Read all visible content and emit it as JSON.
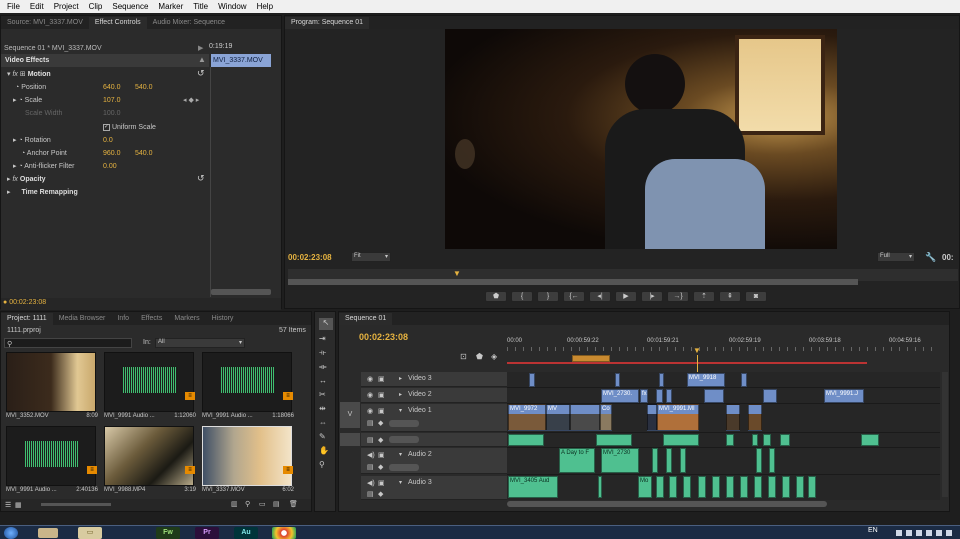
{
  "menu": [
    "File",
    "Edit",
    "Project",
    "Clip",
    "Sequence",
    "Marker",
    "Title",
    "Window",
    "Help"
  ],
  "source_tabs": [
    "Source: MVI_3337.MOV",
    "Effect Controls",
    "Audio Mixer: Sequence"
  ],
  "effect_controls": {
    "clip_path": "Sequence 01 * MVI_3337.MOV",
    "ruler_time": "0:19:19",
    "clip_name": "MVI_3337.MOV",
    "heading": "Video Effects",
    "motion": "Motion",
    "position_label": "Position",
    "position_x": "640.0",
    "position_y": "540.0",
    "scale_label": "Scale",
    "scale_value": "107.0",
    "scale_width_label": "Scale Width",
    "scale_width_value": "100.0",
    "uniform_scale": "Uniform Scale",
    "rotation_label": "Rotation",
    "rotation_value": "0.0",
    "anchor_label": "Anchor Point",
    "anchor_x": "960.0",
    "anchor_y": "540.0",
    "antiflicker_label": "Anti-flicker Filter",
    "antiflicker_value": "0.00",
    "opacity": "Opacity",
    "time_remap": "Time Remapping",
    "timecode": "00:02:23:08"
  },
  "program": {
    "tab": "Program: Sequence 01",
    "timecode": "00:02:23:08",
    "fit": "Fit",
    "quality": "Full",
    "end_timecode": "00:"
  },
  "project": {
    "tabs": [
      "Project: 1111",
      "Media Browser",
      "Info",
      "Effects",
      "Markers",
      "History"
    ],
    "filename": "1111.prproj",
    "items_count": "57 Items",
    "in_label": "In:",
    "in_value": "All",
    "items": [
      {
        "name": "MVI_3352.MOV",
        "dur": "8:09"
      },
      {
        "name": "MVI_9991 Audio ...",
        "dur": "1:12060"
      },
      {
        "name": "MVI_9991 Audio ...",
        "dur": "1:18066"
      },
      {
        "name": "MVI_9991 Audio ...",
        "dur": "2:40136"
      },
      {
        "name": "MVI_9988.MP4",
        "dur": "3:19"
      },
      {
        "name": "MVI_3337.MOV",
        "dur": "6:02"
      }
    ]
  },
  "sequence": {
    "tab": "Sequence 01",
    "timecode": "00:02:23:08",
    "ruler": [
      "00:00",
      "00:00:59:22",
      "00:01:59:21",
      "00:02:59:19",
      "00:03:59:18",
      "00:04:59:16"
    ],
    "tracks": {
      "v3": "Video 3",
      "v2": "Video 2",
      "v1": "Video 1",
      "a2": "Audio 2",
      "a3": "Audio 3",
      "v_target": "V"
    },
    "clip_labels": {
      "v3a": "MVI_9918",
      "v2a": "MVI_2730.",
      "v2b": "fx",
      "v2c": "MVI_9991.J",
      "v1a": "MVI_9972",
      "v1b": "MV",
      "v1c": "Co",
      "v1d": "MVI_9991.MI",
      "a2a": "A Day to F",
      "a2b": "MVI_2730",
      "a3a": "MVI_3405 Aud",
      "a3b": "Mo"
    }
  },
  "taskbar": {
    "lang": "EN",
    "apps": [
      "Fw",
      "Pr",
      "Au"
    ]
  },
  "colors": {
    "timecode": "#e6b340",
    "video_clip": "#6f8ec7",
    "audio_clip": "#4fc090",
    "playhead": "#e6b340"
  }
}
